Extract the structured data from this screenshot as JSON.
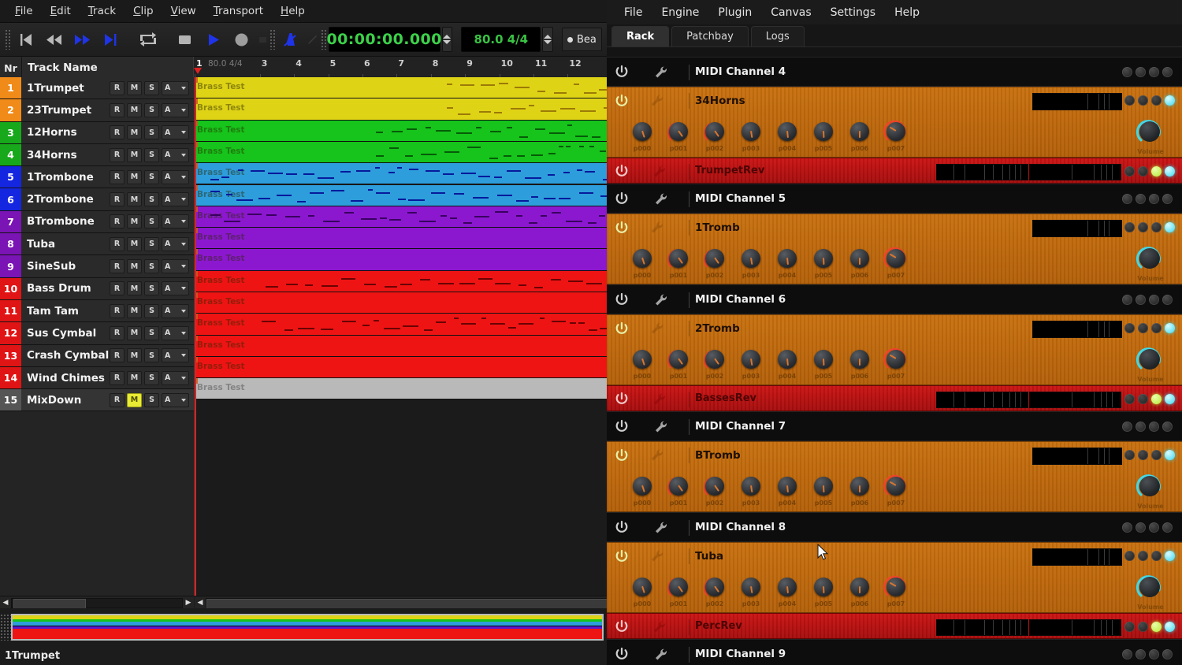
{
  "daw": {
    "menu": [
      "File",
      "Edit",
      "Track",
      "Clip",
      "View",
      "Transport",
      "Help"
    ],
    "toolbar": {
      "icons": [
        "skip-to-start",
        "rewind",
        "fast-forward",
        "skip-to-end",
        "loop",
        "stop",
        "play",
        "record",
        "metronome",
        "pencil-tool"
      ],
      "clock": "00:00:00.000",
      "tempo": "80.0 4/4",
      "beat_label": "Bea"
    },
    "tracklist": {
      "col_nr": "Nr",
      "col_name": "Track Name",
      "buttons": [
        "R",
        "M",
        "S",
        "A"
      ],
      "tracks": [
        {
          "nr": "1",
          "name": "1Trumpet",
          "color": "#f08a18",
          "clip_color": "#dfd316",
          "muted": false
        },
        {
          "nr": "2",
          "name": "23Trumpet",
          "color": "#f08a18",
          "clip_color": "#dfd316",
          "muted": false
        },
        {
          "nr": "3",
          "name": "12Horns",
          "color": "#17a81b",
          "clip_color": "#16c41b",
          "muted": false
        },
        {
          "nr": "4",
          "name": "34Horns",
          "color": "#17a81b",
          "clip_color": "#16c41b",
          "muted": false
        },
        {
          "nr": "5",
          "name": "1Trombone",
          "color": "#1526e0",
          "clip_color": "#2e9ddb",
          "muted": false
        },
        {
          "nr": "6",
          "name": "2Trombone",
          "color": "#1526e0",
          "clip_color": "#2e9ddb",
          "muted": false
        },
        {
          "nr": "7",
          "name": "BTrombone",
          "color": "#7a14b4",
          "clip_color": "#8b18cf",
          "muted": false
        },
        {
          "nr": "8",
          "name": "Tuba",
          "color": "#7a14b4",
          "clip_color": "#8b18cf",
          "muted": false
        },
        {
          "nr": "9",
          "name": "SineSub",
          "color": "#7a14b4",
          "clip_color": "#8b18cf",
          "muted": false
        },
        {
          "nr": "10",
          "name": "Bass Drum",
          "color": "#e01414",
          "clip_color": "#ee1414",
          "muted": false
        },
        {
          "nr": "11",
          "name": "Tam Tam",
          "color": "#e01414",
          "clip_color": "#ee1414",
          "muted": false
        },
        {
          "nr": "12",
          "name": "Sus Cymbal",
          "color": "#e01414",
          "clip_color": "#ee1414",
          "muted": false
        },
        {
          "nr": "13",
          "name": "Crash Cymbal",
          "color": "#e01414",
          "clip_color": "#ee1414",
          "muted": false
        },
        {
          "nr": "14",
          "name": "Wind Chimes",
          "color": "#e01414",
          "clip_color": "#ee1414",
          "muted": false
        },
        {
          "nr": "15",
          "name": "MixDown",
          "color": "#555555",
          "clip_color": "#b9b9b9",
          "muted": true
        }
      ]
    },
    "ruler": {
      "signature": "80.0 4/4",
      "ticks": [
        "1",
        "3",
        "4",
        "5",
        "6",
        "7",
        "8",
        "9",
        "10",
        "11",
        "12"
      ]
    },
    "clip_label": "Brass Test",
    "statusbar": "1Trumpet"
  },
  "carla": {
    "menu": [
      "File",
      "Engine",
      "Plugin",
      "Canvas",
      "Settings",
      "Help"
    ],
    "tabs": [
      {
        "label": "Rack",
        "active": true
      },
      {
        "label": "Patchbay",
        "active": false
      },
      {
        "label": "Logs",
        "active": false
      }
    ],
    "knob_labels": [
      "p000",
      "p001",
      "p002",
      "p003",
      "p004",
      "p005",
      "p006",
      "p007"
    ],
    "volume_label": "Volume",
    "rack": [
      {
        "kind": "empty",
        "title": "MIDI Channel 4"
      },
      {
        "kind": "plugin",
        "title": "34Horns"
      },
      {
        "kind": "reverb",
        "title": "TrumpetRev"
      },
      {
        "kind": "empty",
        "title": "MIDI Channel 5"
      },
      {
        "kind": "plugin",
        "title": "1Tromb"
      },
      {
        "kind": "empty",
        "title": "MIDI Channel 6"
      },
      {
        "kind": "plugin",
        "title": "2Tromb"
      },
      {
        "kind": "reverb",
        "title": "BassesRev"
      },
      {
        "kind": "empty",
        "title": "MIDI Channel 7"
      },
      {
        "kind": "plugin",
        "title": "BTromb"
      },
      {
        "kind": "empty",
        "title": "MIDI Channel 8"
      },
      {
        "kind": "plugin",
        "title": "Tuba"
      },
      {
        "kind": "reverb",
        "title": "PercRev"
      },
      {
        "kind": "empty",
        "title": "MIDI Channel 9"
      }
    ],
    "colors": {
      "plugin_bg": "#c0690c",
      "reverb_bg": "#c01212",
      "led_cyan": "#39d8ef",
      "led_green": "#b6ea37"
    }
  }
}
